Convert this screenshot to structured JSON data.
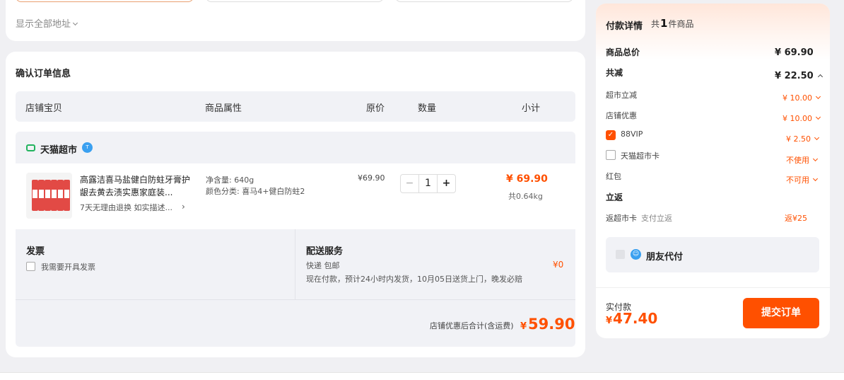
{
  "address": {
    "show_all": "显示全部地址"
  },
  "order": {
    "title": "确认订单信息",
    "headers": {
      "shop_item": "店铺宝贝",
      "attrs": "商品属性",
      "price": "原价",
      "qty": "数量",
      "subtotal": "小计"
    },
    "shop_name": "天猫超市",
    "item": {
      "title": "高露洁喜马盐健白防蛀牙膏护龈去黄去渍实惠家庭装...",
      "tags": "7天无理由退换  如实描述...",
      "tags_arrow": "›",
      "attr1": "净含量: 640g",
      "attr2": "颜色分类: 喜马4+健白防蛀2",
      "price": "¥69.90",
      "qty": "1",
      "minus": "−",
      "plus": "+",
      "subtotal": "¥ 69.90",
      "weight": "共0.64kg"
    },
    "invoice": {
      "title": "发票",
      "option": "我需要开具发票"
    },
    "delivery": {
      "title": "配送服务",
      "method": "快递 包邮",
      "desc": "现在付款，预计24小时内发货，10月05日送货上门，晚发必赔",
      "fee": "¥0"
    },
    "total": {
      "label": "店铺优惠后合计(含运费)",
      "currency": "¥",
      "value": "59.90"
    }
  },
  "payment": {
    "title": "付款详情",
    "count_prefix": "共",
    "count": "1",
    "count_suffix": "件商品",
    "goods_total_label": "商品总价",
    "goods_total": "¥ 69.90",
    "reduce_label": "共减",
    "reduce_total": "¥ 22.50",
    "discounts": [
      {
        "label": "超市立减",
        "value": "¥ 10.00"
      },
      {
        "label": "店铺优惠",
        "value": "¥ 10.00"
      },
      {
        "label": "88VIP",
        "value": "¥ 2.50"
      },
      {
        "label": "天猫超市卡",
        "value": "不使用"
      },
      {
        "label": "红包",
        "value": "不可用"
      }
    ],
    "rebate_title": "立返",
    "rebate_label": "返超市卡",
    "rebate_sub": "支付立返",
    "rebate_value": "返¥25",
    "friend_pay": "朋友代付",
    "paid_label": "实付款",
    "paid_currency": "¥",
    "paid_value": "47.40",
    "submit": "提交订单"
  },
  "colors": {
    "accent": "#ff5000",
    "panel": "#f1f2f6",
    "brand_green": "#22b35e",
    "badge_blue": "#3aa0f0"
  },
  "icons": [
    "tmall-icon",
    "shop-badge-icon",
    "chevron-down-icon",
    "chevron-up-icon",
    "checkbox-icon",
    "friend-pay-icon"
  ]
}
